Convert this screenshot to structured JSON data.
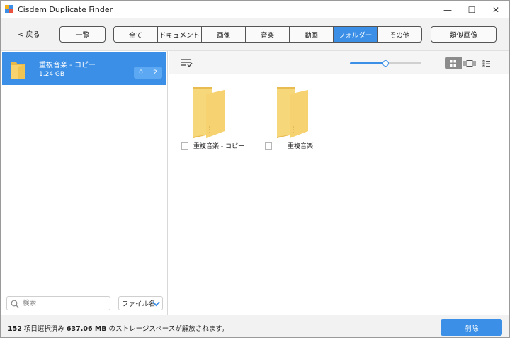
{
  "window": {
    "title": "Cisdem Duplicate Finder",
    "minimize_glyph": "—",
    "maximize_glyph": "☐",
    "close_glyph": "✕"
  },
  "toolbar": {
    "back_label": "< 戻る",
    "overview_label": "一覧",
    "categories": [
      {
        "label": "全て",
        "active": false
      },
      {
        "label": "ドキュメント",
        "active": false
      },
      {
        "label": "画像",
        "active": false
      },
      {
        "label": "音楽",
        "active": false
      },
      {
        "label": "動画",
        "active": false
      },
      {
        "label": "フォルダー",
        "active": true
      },
      {
        "label": "その他",
        "active": false
      }
    ],
    "similar_label": "類似画像"
  },
  "left_panel": {
    "group": {
      "name": "重複音楽 - コピー",
      "size": "1.24 GB",
      "badge_left": "0",
      "badge_right": "2",
      "icon": "folder-icon"
    },
    "search": {
      "placeholder": "検索",
      "icon": "search-icon"
    },
    "sort": {
      "label": "ファイル名",
      "icon": "chevron-down-icon"
    }
  },
  "right_panel": {
    "zoom_percent": 50,
    "view_modes": [
      {
        "name": "grid-view-icon",
        "active": true
      },
      {
        "name": "carousel-view-icon",
        "active": false
      },
      {
        "name": "list-view-icon",
        "active": false
      }
    ],
    "files": [
      {
        "name": "重複音楽 - コピー",
        "checked": false
      },
      {
        "name": "重複音楽",
        "checked": false
      }
    ]
  },
  "footer": {
    "count": "152",
    "selected_text": " 項目選択済み ",
    "size": "637.06 MB",
    "freed_text": " のストレージスペースが解放されます。",
    "delete_label": "削除"
  },
  "colors": {
    "accent": "#3b8fe6",
    "folder": "#f3cd63"
  }
}
